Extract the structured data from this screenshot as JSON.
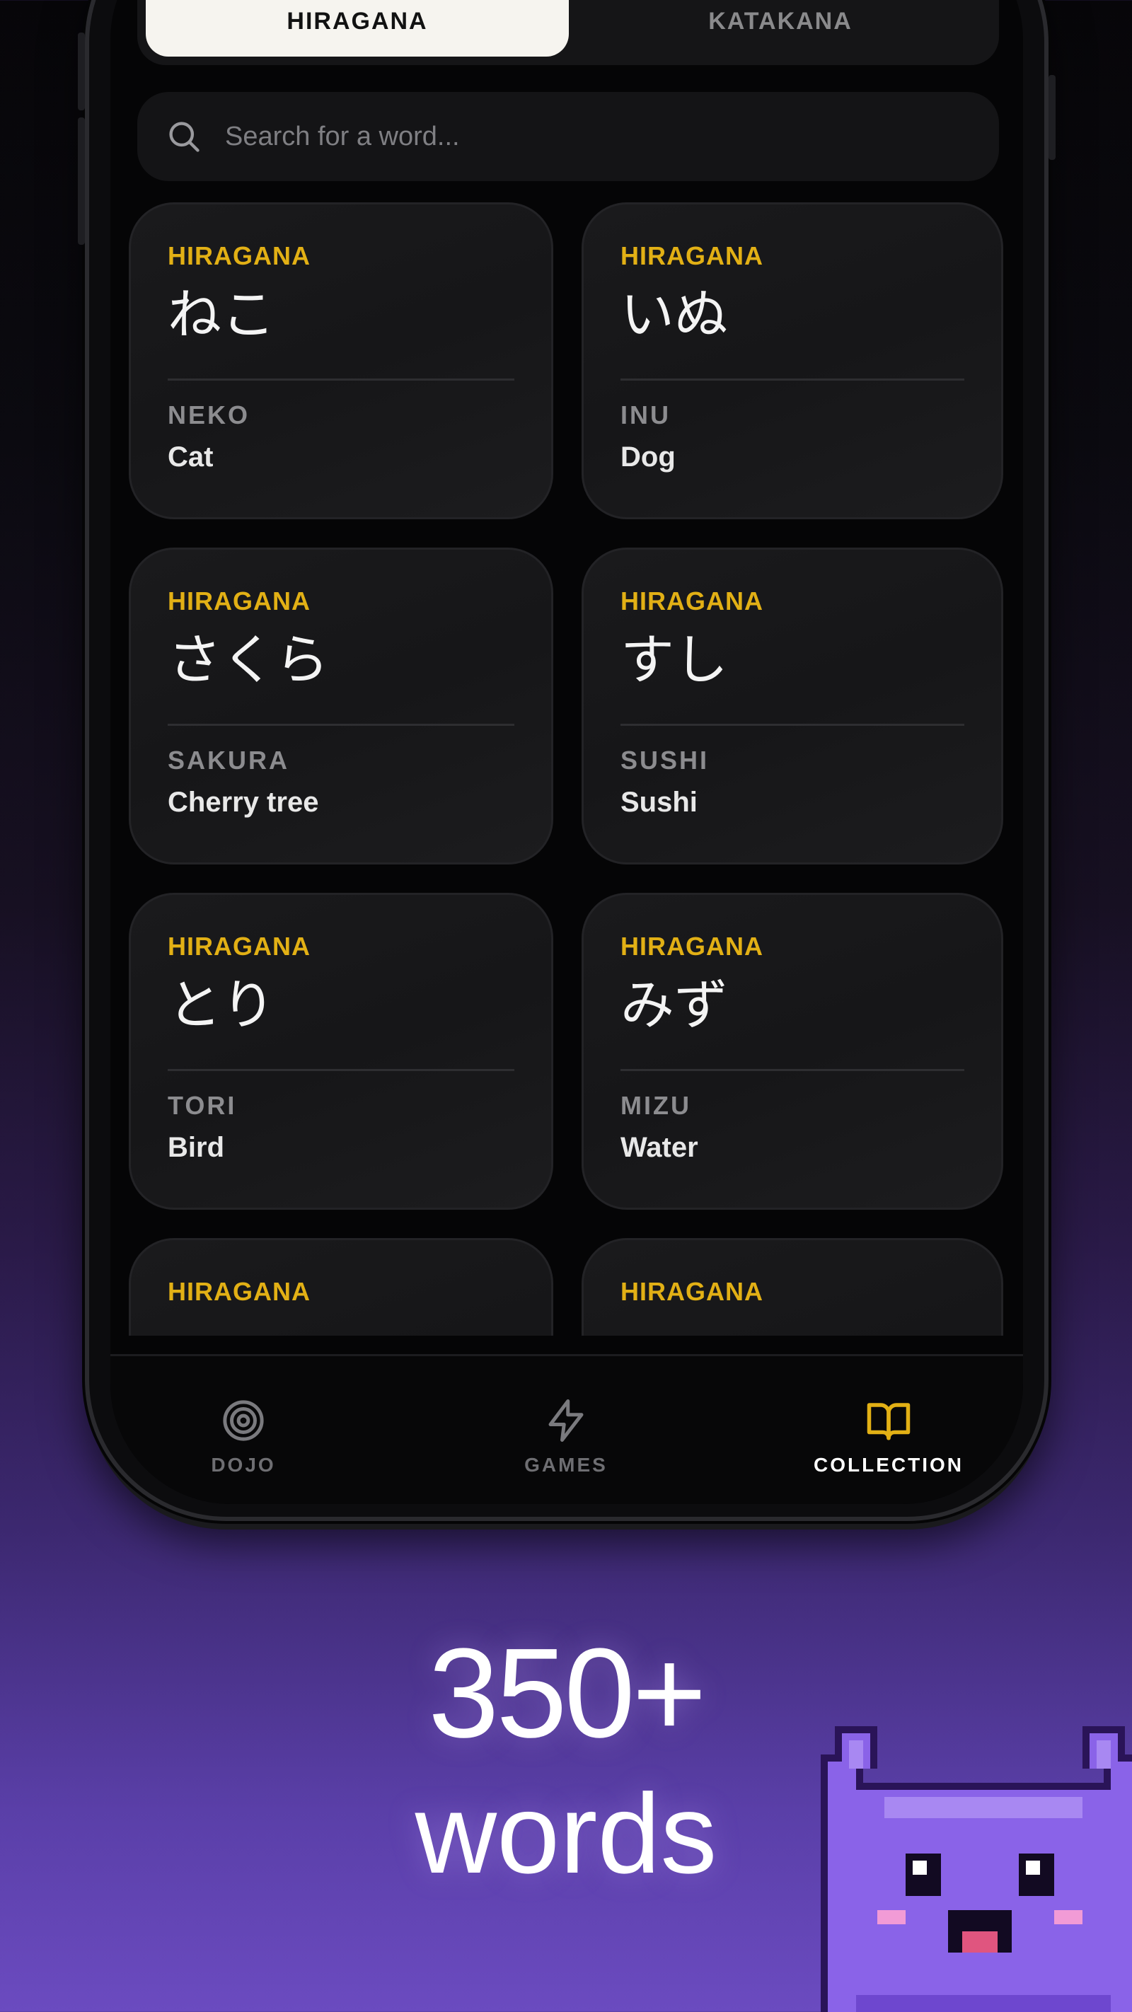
{
  "tabs": {
    "hiragana_label": "HIRAGANA",
    "katakana_label": "KATAKANA",
    "active": "HIRAGANA"
  },
  "search": {
    "placeholder": "Search for a word..."
  },
  "cards": [
    {
      "script": "HIRAGANA",
      "kana": "ねこ",
      "romaji": "NEKO",
      "meaning": "Cat"
    },
    {
      "script": "HIRAGANA",
      "kana": "いぬ",
      "romaji": "INU",
      "meaning": "Dog"
    },
    {
      "script": "HIRAGANA",
      "kana": "さくら",
      "romaji": "SAKURA",
      "meaning": "Cherry tree"
    },
    {
      "script": "HIRAGANA",
      "kana": "すし",
      "romaji": "SUSHI",
      "meaning": "Sushi"
    },
    {
      "script": "HIRAGANA",
      "kana": "とり",
      "romaji": "TORI",
      "meaning": "Bird"
    },
    {
      "script": "HIRAGANA",
      "kana": "みず",
      "romaji": "MIZU",
      "meaning": "Water"
    },
    {
      "script": "HIRAGANA",
      "kana": "",
      "romaji": "",
      "meaning": ""
    },
    {
      "script": "HIRAGANA",
      "kana": "",
      "romaji": "",
      "meaning": ""
    }
  ],
  "nav": {
    "dojo": {
      "label": "DOJO",
      "icon": "target-icon"
    },
    "games": {
      "label": "GAMES",
      "icon": "lightning-icon"
    },
    "collection": {
      "label": "COLLECTION",
      "icon": "book-icon",
      "active": true
    }
  },
  "promo": {
    "number": "350+",
    "unit": "words"
  },
  "colors": {
    "accent_yellow": "#e2b015",
    "active_tab_bg": "#f6f4ef",
    "card_bg": "#18181a",
    "mascot_purple": "#8a63e8"
  }
}
